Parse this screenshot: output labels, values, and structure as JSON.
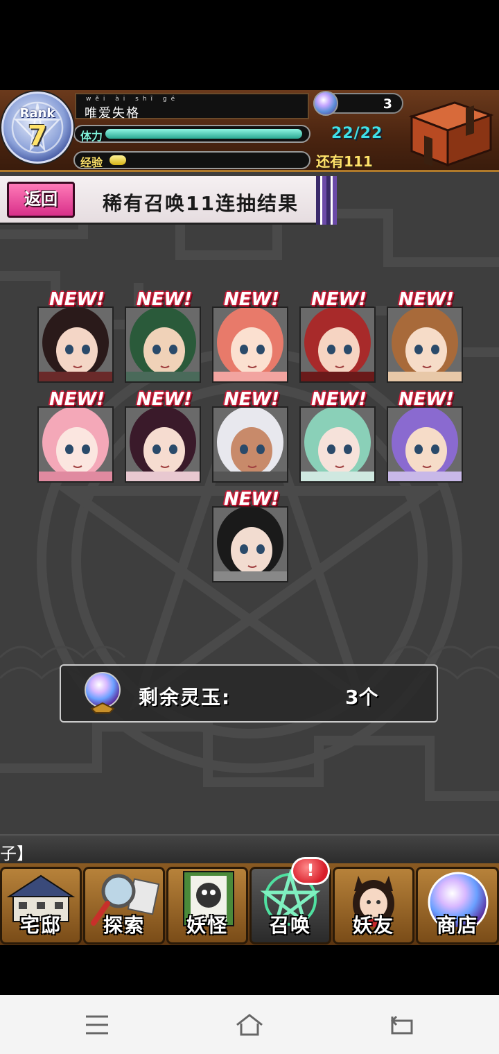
{
  "header": {
    "rank_label": "Rank",
    "rank_value": "7",
    "player_name_ruby": "wěi ài shī gé",
    "player_name": "唯爱失格",
    "orb_count": "3",
    "stamina_label": "体力",
    "stamina_value": "22/22",
    "exp_label": "经验",
    "exp_remaining": "还有111",
    "stamina_fraction": 1.0,
    "exp_fraction": 0.08
  },
  "title_bar": {
    "back_label": "返回",
    "title": "稀有召唤11连抽结果"
  },
  "results": {
    "new_badge": "NEW!",
    "characters": [
      {
        "name": "character-1"
      },
      {
        "name": "character-2"
      },
      {
        "name": "character-3"
      },
      {
        "name": "character-4"
      },
      {
        "name": "character-5"
      },
      {
        "name": "character-6"
      },
      {
        "name": "character-7"
      },
      {
        "name": "character-8"
      },
      {
        "name": "character-9"
      },
      {
        "name": "character-10"
      },
      {
        "name": "character-11"
      }
    ]
  },
  "remaining": {
    "label": "剩余灵玉:",
    "value": "3个"
  },
  "ticker": {
    "text": "子】"
  },
  "nav": {
    "items": [
      {
        "label": "宅邸"
      },
      {
        "label": "探索"
      },
      {
        "label": "妖怪"
      },
      {
        "label": "召唤"
      },
      {
        "label": "妖友"
      },
      {
        "label": "商店"
      }
    ],
    "notification": "!"
  },
  "colors": {
    "header_brown": "#4a2410",
    "stamina": "#2aa891",
    "exp": "#d6b316",
    "back_pink": "#d8308a",
    "new_red": "#c81e3a"
  }
}
